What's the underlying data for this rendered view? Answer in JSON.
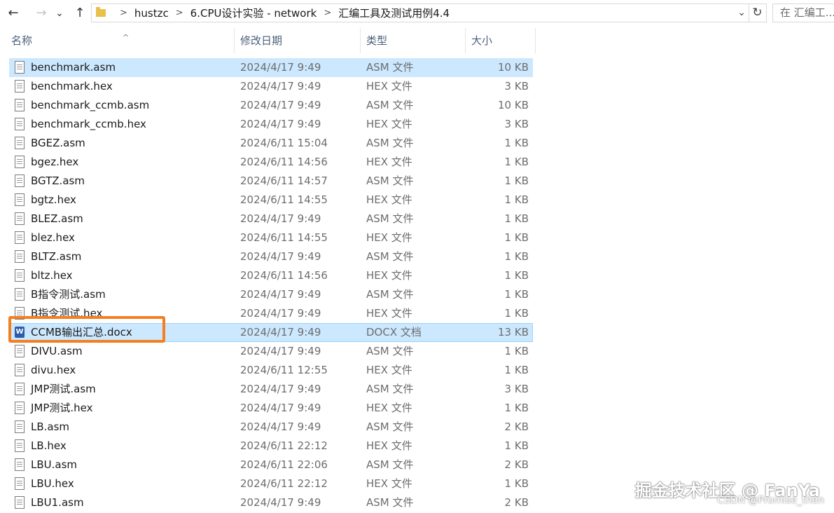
{
  "nav": {
    "back_icon": "arrow-left-icon",
    "forward_icon": "arrow-right-icon",
    "recent_icon": "chevron-down-icon",
    "up_icon": "arrow-up-icon",
    "back_glyph": "←",
    "forward_glyph": "→",
    "recent_glyph": "⌄",
    "up_glyph": "↑"
  },
  "address": {
    "crumbs": [
      "hustzc",
      "6.CPU设计实验 - network",
      "汇编工具及测试用例4.4"
    ],
    "separator": ">",
    "dropdown_glyph": "⌄",
    "refresh_glyph": "↻"
  },
  "search": {
    "placeholder": "在 汇编工..."
  },
  "columns": {
    "name": "名称",
    "date": "修改日期",
    "type": "类型",
    "size": "大小",
    "sort_glyph": "^"
  },
  "files": [
    {
      "name": "benchmark.asm",
      "date": "2024/4/17 9:49",
      "type": "ASM 文件",
      "size": "10 KB",
      "icon": "text-file-icon"
    },
    {
      "name": "benchmark.hex",
      "date": "2024/4/17 9:49",
      "type": "HEX 文件",
      "size": "3 KB",
      "icon": "text-file-icon"
    },
    {
      "name": "benchmark_ccmb.asm",
      "date": "2024/4/17 9:49",
      "type": "ASM 文件",
      "size": "10 KB",
      "icon": "text-file-icon"
    },
    {
      "name": "benchmark_ccmb.hex",
      "date": "2024/4/17 9:49",
      "type": "HEX 文件",
      "size": "3 KB",
      "icon": "text-file-icon"
    },
    {
      "name": "BGEZ.asm",
      "date": "2024/6/11 15:04",
      "type": "ASM 文件",
      "size": "1 KB",
      "icon": "text-file-icon"
    },
    {
      "name": "bgez.hex",
      "date": "2024/6/11 14:56",
      "type": "HEX 文件",
      "size": "1 KB",
      "icon": "text-file-icon"
    },
    {
      "name": "BGTZ.asm",
      "date": "2024/6/11 14:57",
      "type": "ASM 文件",
      "size": "1 KB",
      "icon": "text-file-icon"
    },
    {
      "name": "bgtz.hex",
      "date": "2024/6/11 14:55",
      "type": "HEX 文件",
      "size": "1 KB",
      "icon": "text-file-icon"
    },
    {
      "name": "BLEZ.asm",
      "date": "2024/4/17 9:49",
      "type": "ASM 文件",
      "size": "1 KB",
      "icon": "text-file-icon"
    },
    {
      "name": "blez.hex",
      "date": "2024/6/11 14:55",
      "type": "HEX 文件",
      "size": "1 KB",
      "icon": "text-file-icon"
    },
    {
      "name": "BLTZ.asm",
      "date": "2024/4/17 9:49",
      "type": "ASM 文件",
      "size": "1 KB",
      "icon": "text-file-icon"
    },
    {
      "name": "bltz.hex",
      "date": "2024/6/11 14:56",
      "type": "HEX 文件",
      "size": "1 KB",
      "icon": "text-file-icon"
    },
    {
      "name": "B指令测试.asm",
      "date": "2024/4/17 9:49",
      "type": "ASM 文件",
      "size": "1 KB",
      "icon": "text-file-icon"
    },
    {
      "name": "B指令测试.hex",
      "date": "2024/4/17 9:49",
      "type": "HEX 文件",
      "size": "1 KB",
      "icon": "text-file-icon"
    },
    {
      "name": "CCMB输出汇总.docx",
      "date": "2024/4/17 9:49",
      "type": "DOCX 文档",
      "size": "13 KB",
      "icon": "word-doc-icon",
      "highlighted": true
    },
    {
      "name": "DIVU.asm",
      "date": "2024/4/17 9:49",
      "type": "ASM 文件",
      "size": "1 KB",
      "icon": "text-file-icon"
    },
    {
      "name": "divu.hex",
      "date": "2024/6/11 12:55",
      "type": "HEX 文件",
      "size": "1 KB",
      "icon": "text-file-icon"
    },
    {
      "name": "JMP测试.asm",
      "date": "2024/4/17 9:49",
      "type": "ASM 文件",
      "size": "3 KB",
      "icon": "text-file-icon"
    },
    {
      "name": "JMP测试.hex",
      "date": "2024/4/17 9:49",
      "type": "HEX 文件",
      "size": "1 KB",
      "icon": "text-file-icon"
    },
    {
      "name": "LB.asm",
      "date": "2024/4/17 9:49",
      "type": "ASM 文件",
      "size": "2 KB",
      "icon": "text-file-icon"
    },
    {
      "name": "LB.hex",
      "date": "2024/6/11 22:12",
      "type": "HEX 文件",
      "size": "1 KB",
      "icon": "text-file-icon"
    },
    {
      "name": "LBU.asm",
      "date": "2024/6/11 22:06",
      "type": "ASM 文件",
      "size": "2 KB",
      "icon": "text-file-icon"
    },
    {
      "name": "LBU.hex",
      "date": "2024/6/11 22:12",
      "type": "HEX 文件",
      "size": "1 KB",
      "icon": "text-file-icon"
    },
    {
      "name": "LBU1.asm",
      "date": "2024/4/17 9:49",
      "type": "ASM 文件",
      "size": "2 KB",
      "icon": "text-file-icon"
    }
  ],
  "word_icon_letter": "W",
  "highlight_color": "#f47f20",
  "selection_color": "#cce8ff",
  "watermark": {
    "main": "掘金技术社区 @ FanYa",
    "sub": "CSDN @Promise_then"
  }
}
